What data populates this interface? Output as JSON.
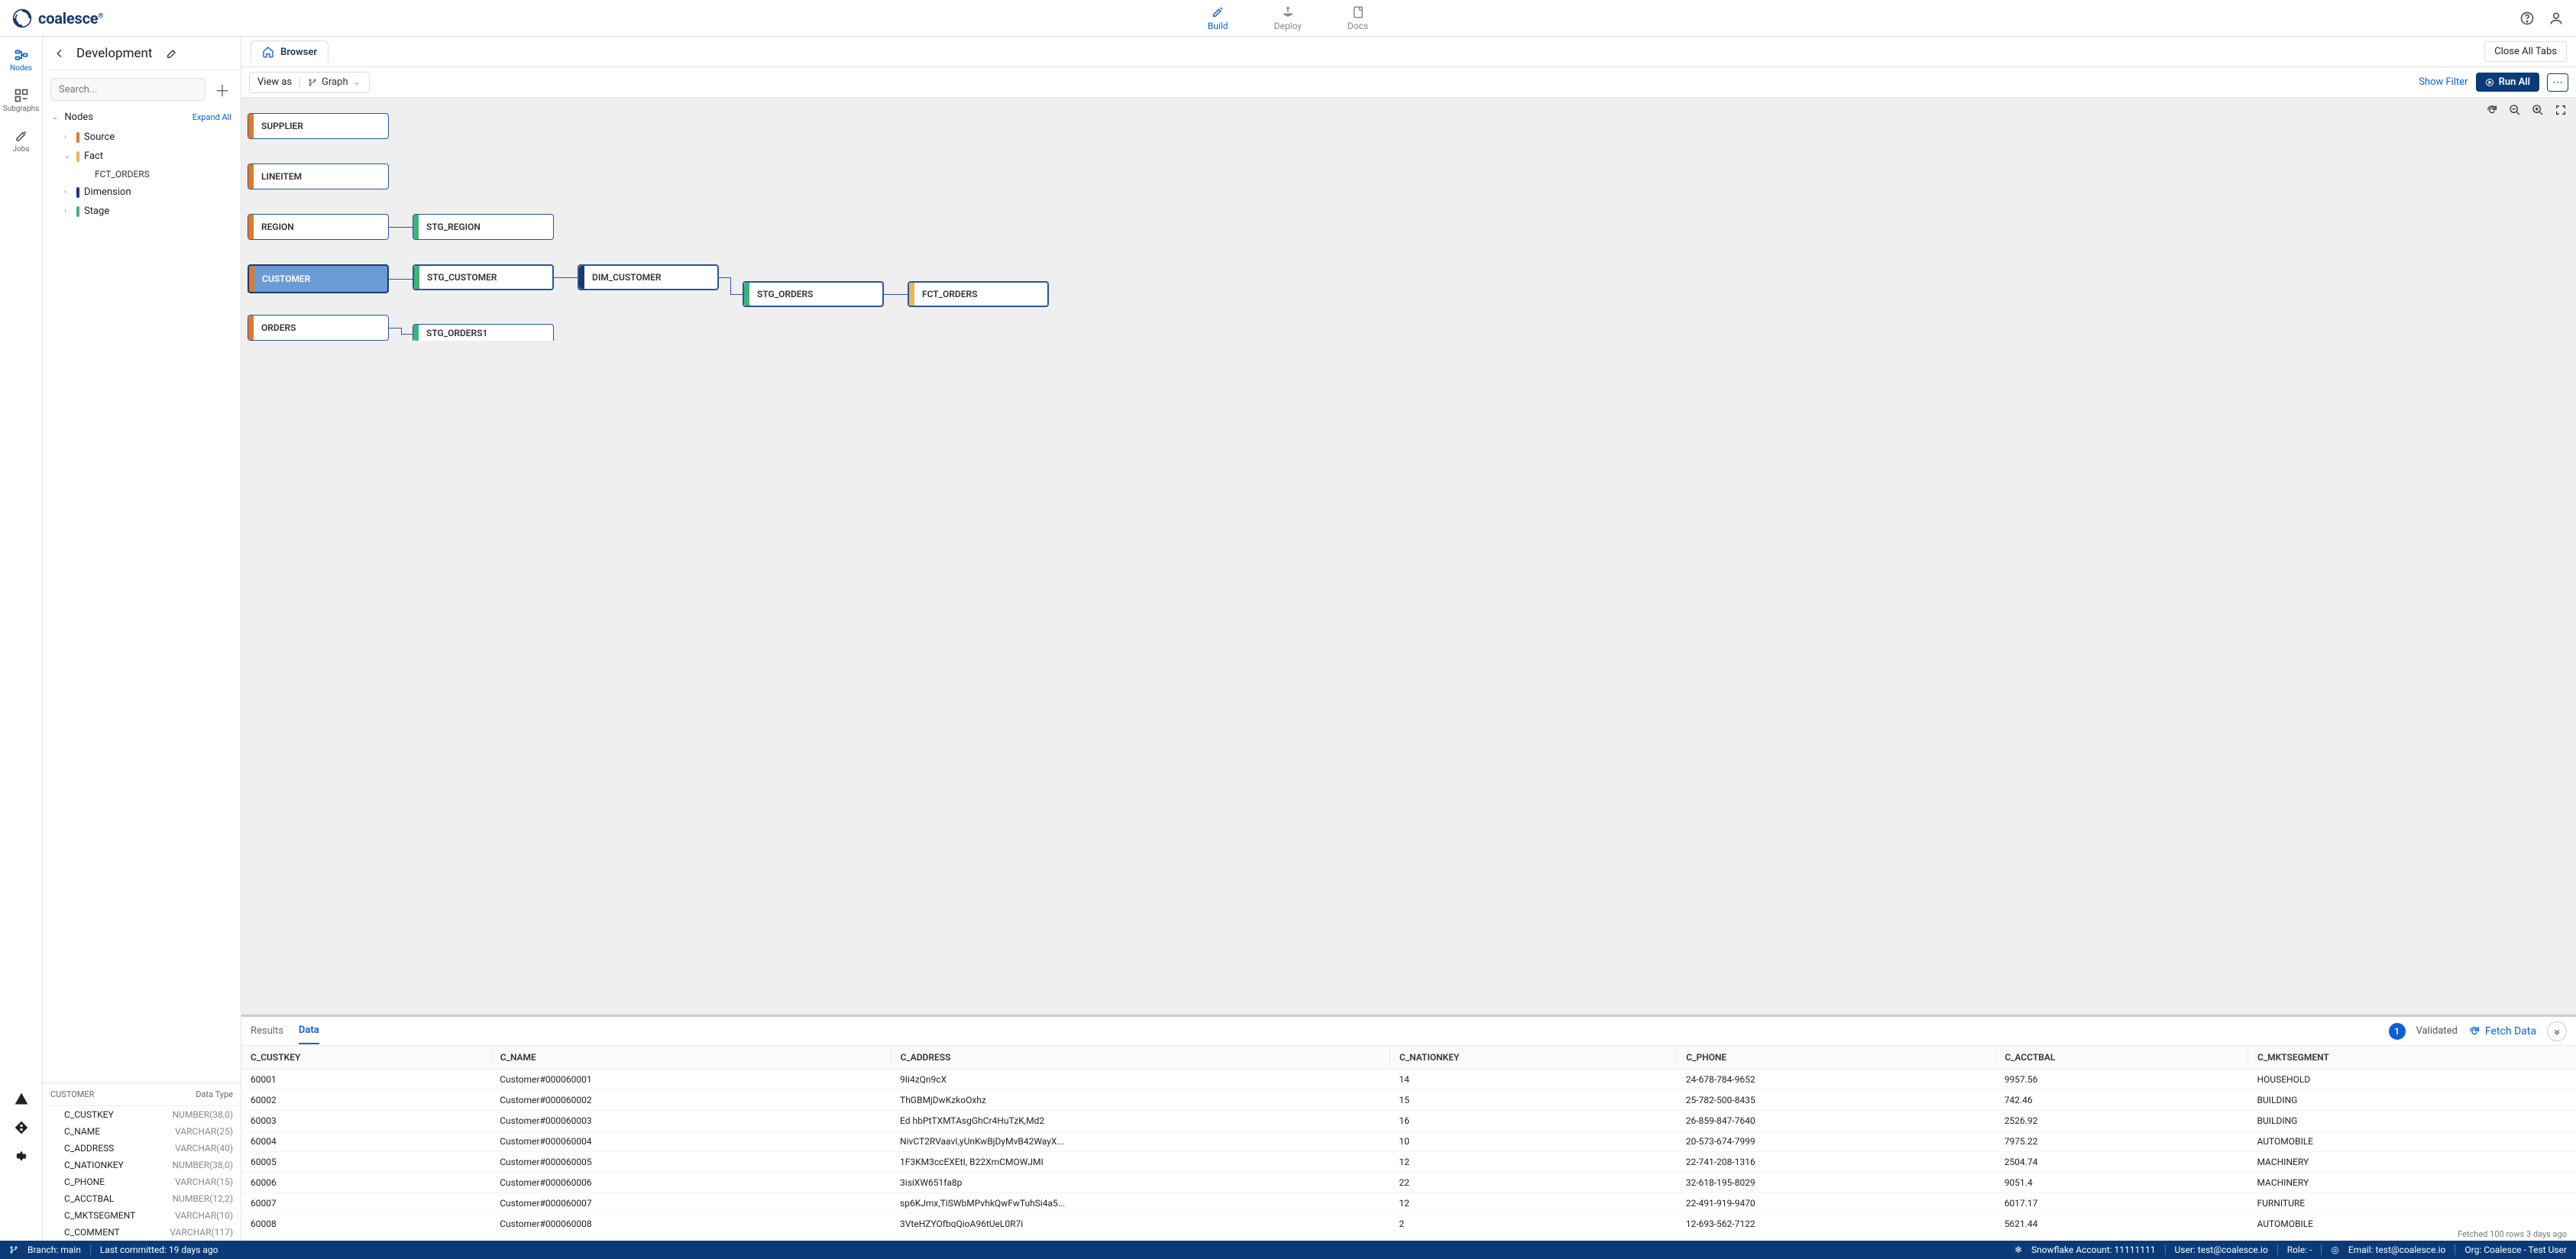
{
  "brand": {
    "name": "coalesce"
  },
  "topnav": {
    "build": "Build",
    "deploy": "Deploy",
    "docs": "Docs"
  },
  "sidepanel": {
    "title": "Development",
    "search_placeholder": "Search...",
    "nodes_label": "Nodes",
    "expand_all": "Expand All",
    "groups": {
      "source": "Source",
      "fact": "Fact",
      "fact_leaf": "FCT_ORDERS",
      "dimension": "Dimension",
      "stage": "Stage"
    }
  },
  "iconrail": {
    "nodes": "Nodes",
    "subgraphs": "Subgraphs",
    "jobs": "Jobs"
  },
  "wtabs": {
    "browser": "Browser",
    "close_all": "Close All Tabs"
  },
  "wbar": {
    "viewas": "View as",
    "graph": "Graph",
    "show_filter": "Show Filter",
    "run_all": "Run All"
  },
  "graph": {
    "supplier": "SUPPLIER",
    "lineitem": "LINEITEM",
    "region": "REGION",
    "stg_region": "STG_REGION",
    "customer": "CUSTOMER",
    "stg_customer": "STG_CUSTOMER",
    "dim_customer": "DIM_CUSTOMER",
    "stg_orders": "STG_ORDERS",
    "fct_orders": "FCT_ORDERS",
    "orders": "ORDERS",
    "stg_orders1": "STG_ORDERS1"
  },
  "colprev": {
    "head_name": "CUSTOMER",
    "head_type": "Data Type",
    "rows": [
      {
        "n": "C_CUSTKEY",
        "t": "NUMBER(38,0)"
      },
      {
        "n": "C_NAME",
        "t": "VARCHAR(25)"
      },
      {
        "n": "C_ADDRESS",
        "t": "VARCHAR(40)"
      },
      {
        "n": "C_NATIONKEY",
        "t": "NUMBER(38,0)"
      },
      {
        "n": "C_PHONE",
        "t": "VARCHAR(15)"
      },
      {
        "n": "C_ACCTBAL",
        "t": "NUMBER(12,2)"
      },
      {
        "n": "C_MKTSEGMENT",
        "t": "VARCHAR(10)"
      },
      {
        "n": "C_COMMENT",
        "t": "VARCHAR(117)"
      }
    ]
  },
  "datapane": {
    "tab_results": "Results",
    "tab_data": "Data",
    "badge": "1",
    "validated": "Validated",
    "fetch": "Fetch Data",
    "columns": [
      "C_CUSTKEY",
      "C_NAME",
      "C_ADDRESS",
      "C_NATIONKEY",
      "C_PHONE",
      "C_ACCTBAL",
      "C_MKTSEGMENT"
    ],
    "rows": [
      [
        "60001",
        "Customer#000060001",
        "9Ii4zQn9cX",
        "14",
        "24-678-784-9652",
        "9957.56",
        "HOUSEHOLD"
      ],
      [
        "60002",
        "Customer#000060002",
        "ThGBMjDwKzkoOxhz",
        "15",
        "25-782-500-8435",
        "742.46",
        "BUILDING"
      ],
      [
        "60003",
        "Customer#000060003",
        "Ed hbPtTXMTAsgGhCr4HuTzK,Md2",
        "16",
        "26-859-847-7640",
        "2526.92",
        "BUILDING"
      ],
      [
        "60004",
        "Customer#000060004",
        "NivCT2RVaavI,yUnKwBjDyMvB42WayX...",
        "10",
        "20-573-674-7999",
        "7975.22",
        "AUTOMOBILE"
      ],
      [
        "60005",
        "Customer#000060005",
        "1F3KM3ccEXEtI, B22XmCMOWJMI",
        "12",
        "22-741-208-1316",
        "2504.74",
        "MACHINERY"
      ],
      [
        "60006",
        "Customer#000060006",
        "3isiXW651fa8p",
        "22",
        "32-618-195-8029",
        "9051.4",
        "MACHINERY"
      ],
      [
        "60007",
        "Customer#000060007",
        "sp6KJmx,TiSWbMPvhkQwFwTuhSi4a5...",
        "12",
        "22-491-919-9470",
        "6017.17",
        "FURNITURE"
      ],
      [
        "60008",
        "Customer#000060008",
        "3VteHZYOfbqQioA96tUeL0R7i",
        "2",
        "12-693-562-7122",
        "5621.44",
        "AUTOMOBILE"
      ]
    ],
    "footer": "Fetched 100 rows   3 days ago"
  },
  "statusbar": {
    "branch": "Branch: main",
    "last_commit": "Last committed: 19 days ago",
    "sf_account": "Snowflake Account: 11111111",
    "user": "User: test@coalesce.io",
    "role": "Role: -",
    "email": "Email: test@coalesce.io",
    "org": "Org: Coalesce - Test User"
  }
}
